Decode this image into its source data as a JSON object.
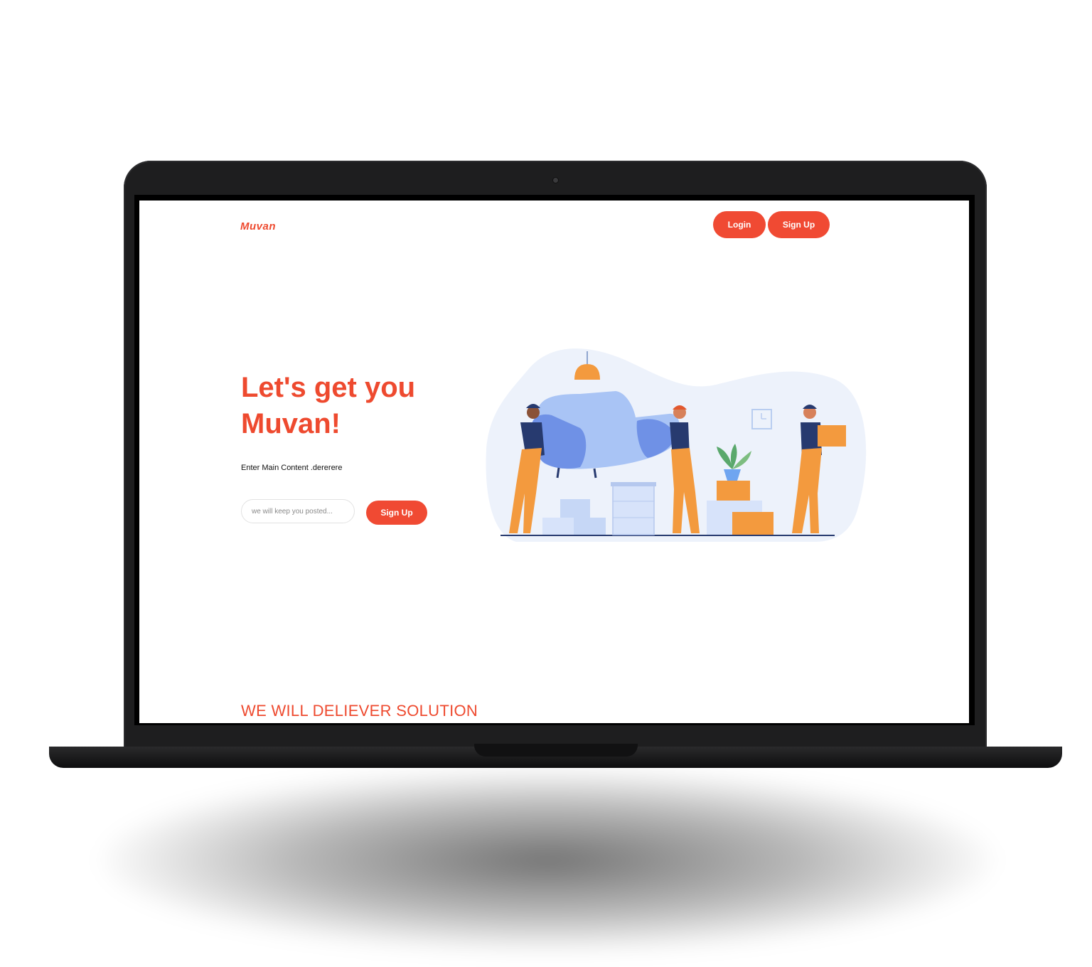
{
  "app": {
    "logo_text": "Muvan",
    "brand_color": "#f04a33"
  },
  "header": {
    "login_label": "Login",
    "signup_label": "Sign Up"
  },
  "hero": {
    "title": "Let's get you Muvan!",
    "subtitle": "Enter Main Content .dererere",
    "email_placeholder": "we will keep you posted...",
    "signup_label": "Sign Up",
    "illustration": "movers-carrying-furniture"
  },
  "section": {
    "title": "WE WILL DELIEVER SOLUTION"
  }
}
